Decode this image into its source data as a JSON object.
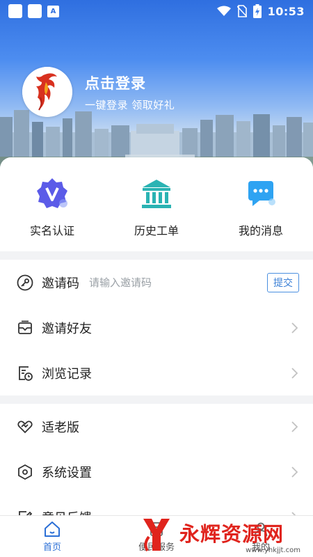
{
  "status_bar": {
    "time": "10:53",
    "icons": [
      "notification-square-icon",
      "notification-square-icon",
      "font-a-icon",
      "wifi-icon",
      "no-sim-icon",
      "battery-charging-icon"
    ]
  },
  "profile": {
    "login_title": "点击登录",
    "login_subtitle": "一键登录  领取好礼"
  },
  "quick_actions": [
    {
      "label": "实名认证",
      "icon": "verified-v-badge-icon",
      "color": "#5b5be8"
    },
    {
      "label": "历史工单",
      "icon": "bank-building-icon",
      "color": "#2ab3b3"
    },
    {
      "label": "我的消息",
      "icon": "chat-bubble-icon",
      "color": "#2ea3f2"
    }
  ],
  "invite_code": {
    "label": "邀请码",
    "placeholder": "请输入邀请码",
    "value": "",
    "submit_label": "提交"
  },
  "menu_group_1": [
    {
      "label": "邀请好友",
      "icon": "envelope-icon"
    },
    {
      "label": "浏览记录",
      "icon": "history-log-icon"
    }
  ],
  "menu_group_2": [
    {
      "label": "适老版",
      "icon": "heart-hands-icon"
    },
    {
      "label": "系统设置",
      "icon": "settings-hexagon-icon"
    },
    {
      "label": "意见反馈",
      "icon": "feedback-edit-icon"
    }
  ],
  "bottom_nav": [
    {
      "label": "首页",
      "icon": "home-icon",
      "active": true
    },
    {
      "label": "便民服务",
      "icon": "service-icon",
      "active": false
    },
    {
      "label": "我的",
      "icon": "user-icon",
      "active": false
    }
  ],
  "watermark": {
    "text": "永辉资源网",
    "url": "www.yhkjjt.com"
  },
  "colors": {
    "accent": "#2b6fd6",
    "watermark_red": "#e0241d"
  }
}
